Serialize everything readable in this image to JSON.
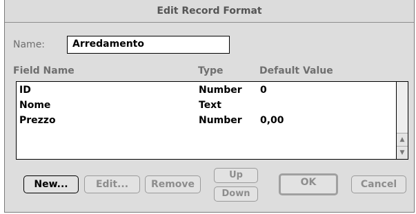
{
  "window": {
    "title": "Edit Record Format"
  },
  "name_field": {
    "label": "Name:",
    "value": "Arredamento"
  },
  "table": {
    "headers": {
      "field_name": "Field Name",
      "type": "Type",
      "default_value": "Default Value"
    },
    "rows": [
      {
        "name": "ID",
        "type": "Number",
        "default": "0"
      },
      {
        "name": "Nome",
        "type": "Text",
        "default": ""
      },
      {
        "name": "Prezzo",
        "type": "Number",
        "default": "0,00"
      }
    ]
  },
  "buttons": {
    "new": "New...",
    "edit": "Edit...",
    "remove": "Remove",
    "up": "Up",
    "down": "Down",
    "ok": "OK",
    "cancel": "Cancel"
  },
  "scroll_icons": {
    "up": "scroll-up-arrow",
    "down": "scroll-down-arrow"
  }
}
